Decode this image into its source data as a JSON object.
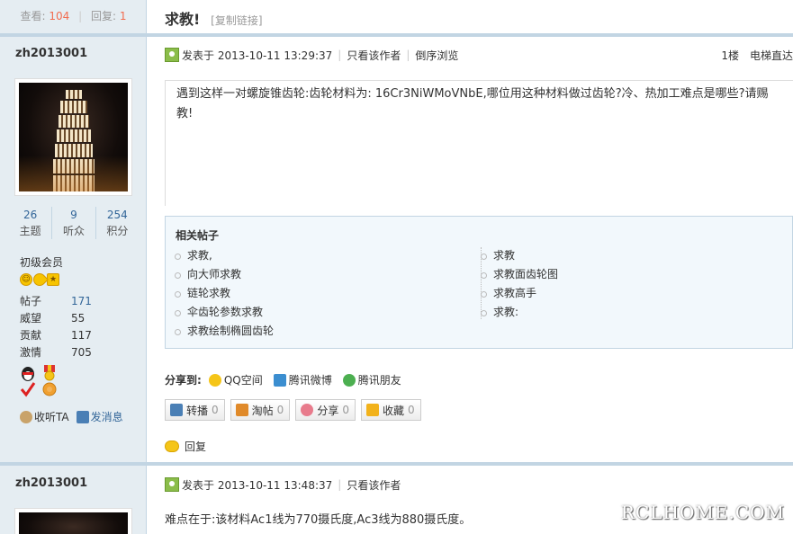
{
  "thread": {
    "views_label": "查看:",
    "views": "104",
    "replies_label": "回复:",
    "replies": "1",
    "title": "求教!",
    "copy_link": "[复制链接]"
  },
  "posts": [
    {
      "author": "zh2013001",
      "stats": [
        {
          "value": "26",
          "label": "主题"
        },
        {
          "value": "9",
          "label": "听众"
        },
        {
          "value": "254",
          "label": "积分"
        }
      ],
      "rank": "初级会员",
      "profile": [
        {
          "key": "帖子",
          "value": "171",
          "link": true
        },
        {
          "key": "威望",
          "value": "55",
          "link": false
        },
        {
          "key": "贡献",
          "value": "117",
          "link": false
        },
        {
          "key": "激情",
          "value": "705",
          "link": false
        }
      ],
      "follow_label": "收听TA",
      "message_label": "发消息",
      "posted": "发表于 2013-10-11 13:29:37",
      "only_author": "只看该作者",
      "reverse": "倒序浏览",
      "floor": "1楼",
      "elevator": "电梯直达",
      "content": "遇到这样一对螺旋锥齿轮:齿轮材料为: 16Cr3NiWMoVNbE,哪位用这种材料做过齿轮?冷、热加工难点是哪些?请赐教!",
      "related": {
        "title": "相关帖子",
        "left": [
          "求教,",
          "向大师求教",
          "链轮求教",
          "伞齿轮参数求教",
          "求教绘制椭圆齿轮"
        ],
        "right": [
          "求教",
          "求教面齿轮图",
          "求教高手",
          "求教:"
        ]
      },
      "share": {
        "label": "分享到:",
        "items": [
          "QQ空间",
          "腾讯微博",
          "腾讯朋友"
        ]
      },
      "buttons": [
        {
          "label": "转播",
          "count": "0",
          "color": "#4a7fb5"
        },
        {
          "label": "淘帖",
          "count": "0",
          "color": "#e08a2a"
        },
        {
          "label": "分享",
          "count": "0",
          "color": "#e87b8c"
        },
        {
          "label": "收藏",
          "count": "0",
          "color": "#f2b21b"
        }
      ],
      "reply_label": "回复"
    },
    {
      "author": "zh2013001",
      "posted": "发表于 2013-10-11 13:48:37",
      "only_author": "只看该作者",
      "content": "难点在于:该材料Ac1线为770摄氏度,Ac3线为880摄氏度。"
    }
  ],
  "watermark": "RCLHOME.COM"
}
